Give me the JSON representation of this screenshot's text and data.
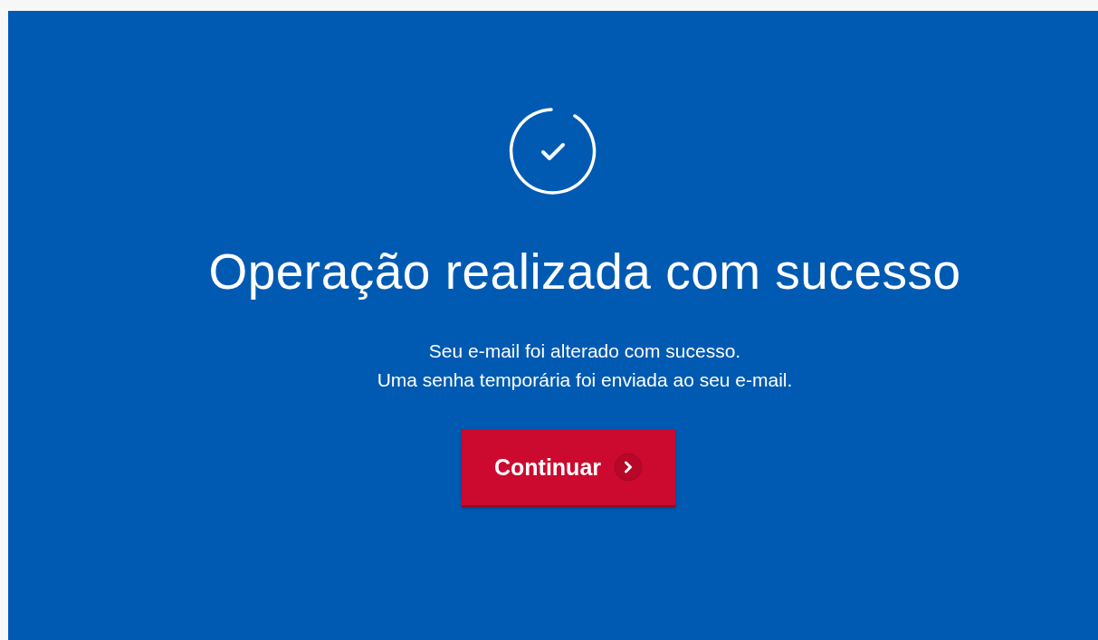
{
  "title": "Operação realizada com sucesso",
  "message_lines": [
    "Seu e-mail foi alterado com sucesso.",
    "Uma senha temporária foi enviada ao seu e-mail."
  ],
  "button": {
    "label": "Continuar"
  }
}
